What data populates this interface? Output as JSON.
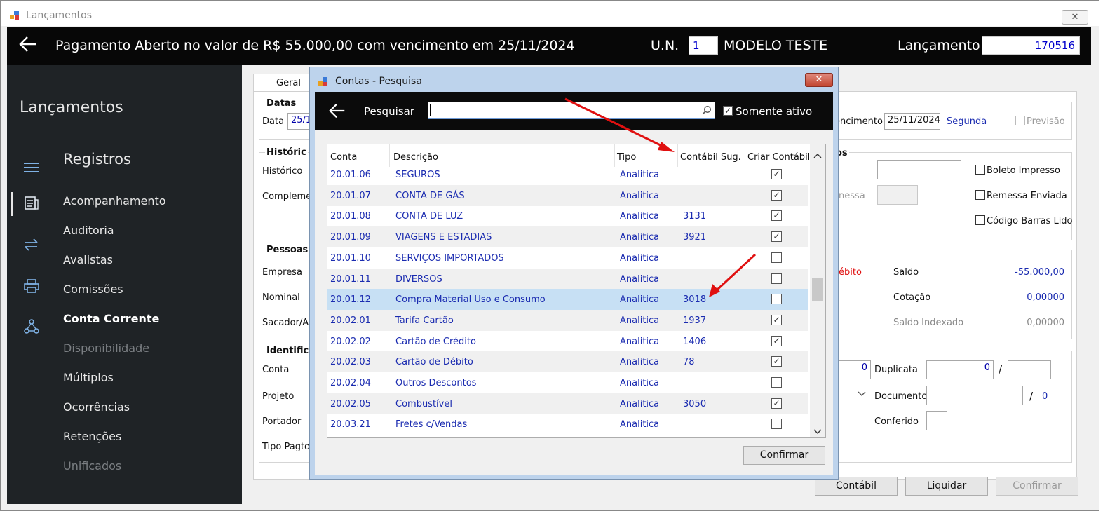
{
  "window": {
    "title": "Lançamentos",
    "close": "✕"
  },
  "header": {
    "title": "Pagamento Aberto no valor de R$ 55.000,00 com vencimento em 25/11/2024",
    "un_label": "U.N.",
    "un_value": "1",
    "un_name": "MODELO TESTE",
    "lanc_label": "Lançamento",
    "lanc_value": "170516"
  },
  "sidebar": {
    "title": "Lançamentos",
    "section": "Registros",
    "items": [
      {
        "label": "Acompanhamento",
        "state": "normal"
      },
      {
        "label": "Auditoria",
        "state": "normal"
      },
      {
        "label": "Avalistas",
        "state": "normal"
      },
      {
        "label": "Comissões",
        "state": "normal"
      },
      {
        "label": "Conta Corrente",
        "state": "bold"
      },
      {
        "label": "Disponibilidade",
        "state": "disabled"
      },
      {
        "label": "Múltiplos",
        "state": "normal"
      },
      {
        "label": "Ocorrências",
        "state": "normal"
      },
      {
        "label": "Retenções",
        "state": "normal"
      },
      {
        "label": "Unificados",
        "state": "disabled"
      }
    ]
  },
  "form": {
    "tab": "Geral",
    "datas_title": "Datas",
    "data_label": "Data",
    "data_value": "25/1",
    "venc_label": "encimento",
    "venc_value": "25/11/2024",
    "venc_day": "Segunda",
    "previsao": "Previsão",
    "historico_title": "Históric",
    "historico_label": "Histórico",
    "complemento_label": "Complemen",
    "right_group_title": "os",
    "boleto": "Boleto Impresso",
    "remessa_label": "nessa",
    "remessa_enviada": "Remessa Enviada",
    "codigo_barras": "Código Barras Lido",
    "pessoas_title": "Pessoas,",
    "empresa_label": "Empresa",
    "nominal_label": "Nominal",
    "sacador_label": "Sacador/A",
    "debito_label": "ébito",
    "saldo_label": "Saldo",
    "saldo_value": "-55.000,00",
    "cotacao_label": "Cotação",
    "cotacao_value": "0,00000",
    "saldo_idx_label": "Saldo Indexado",
    "saldo_idx_value": "0,00000",
    "identif_title": "Identifica",
    "conta_label": "Conta",
    "projeto_label": "Projeto",
    "portador_label": "Portador",
    "tipo_pagto_label": "Tipo Pagto",
    "field_zero": "0",
    "duplicata_label": "Duplicata",
    "duplicata_value": "0",
    "slash": "/",
    "documento_label": "Documento",
    "doc_slash": "/",
    "doc_value": "0",
    "conferido_label": "Conferido"
  },
  "buttons": {
    "contabil": "Contábil",
    "liquidar": "Liquidar",
    "confirmar": "Confirmar"
  },
  "dialog": {
    "title": "Contas - Pesquisa",
    "close": "✕",
    "search_label": "Pesquisar",
    "search_value": "",
    "somente_ativo": "Somente ativo",
    "somente_checked": "✓",
    "columns": [
      "Conta",
      "Descrição",
      "Tipo",
      "Contábil Sug.",
      "Criar Contábil"
    ],
    "rows": [
      {
        "conta": "20.01.06",
        "desc": "SEGUROS",
        "tipo": "Analitica",
        "sug": "",
        "chk": "✓"
      },
      {
        "conta": "20.01.07",
        "desc": "CONTA DE GÁS",
        "tipo": "Analitica",
        "sug": "",
        "chk": "✓"
      },
      {
        "conta": "20.01.08",
        "desc": "CONTA DE LUZ",
        "tipo": "Analitica",
        "sug": "3131",
        "chk": "✓"
      },
      {
        "conta": "20.01.09",
        "desc": "VIAGENS E ESTADIAS",
        "tipo": "Analitica",
        "sug": "3921",
        "chk": "✓"
      },
      {
        "conta": "20.01.10",
        "desc": "SERVIÇOS IMPORTADOS",
        "tipo": "Analitica",
        "sug": "",
        "chk": ""
      },
      {
        "conta": "20.01.11",
        "desc": "DIVERSOS",
        "tipo": "Analitica",
        "sug": "",
        "chk": ""
      },
      {
        "conta": "20.01.12",
        "desc": "Compra Material Uso e Consumo",
        "tipo": "Analitica",
        "sug": "3018",
        "chk": ""
      },
      {
        "conta": "20.02.01",
        "desc": "Tarifa Cartão",
        "tipo": "Analitica",
        "sug": "1937",
        "chk": "✓"
      },
      {
        "conta": "20.02.02",
        "desc": "Cartão de Crédito",
        "tipo": "Analitica",
        "sug": "1406",
        "chk": "✓"
      },
      {
        "conta": "20.02.03",
        "desc": "Cartão de Débito",
        "tipo": "Analitica",
        "sug": "78",
        "chk": "✓"
      },
      {
        "conta": "20.02.04",
        "desc": "Outros Descontos",
        "tipo": "Analitica",
        "sug": "",
        "chk": ""
      },
      {
        "conta": "20.02.05",
        "desc": "Combustível",
        "tipo": "Analitica",
        "sug": "3050",
        "chk": "✓"
      },
      {
        "conta": "20.03.21",
        "desc": "Fretes c/Vendas",
        "tipo": "Analitica",
        "sug": "",
        "chk": ""
      }
    ],
    "selected_row": 6,
    "confirm": "Confirmar"
  },
  "colors": {
    "accent_blue": "#1a2bb0",
    "annotation_red": "#e01010",
    "selected_row": "#c7e0f4"
  }
}
